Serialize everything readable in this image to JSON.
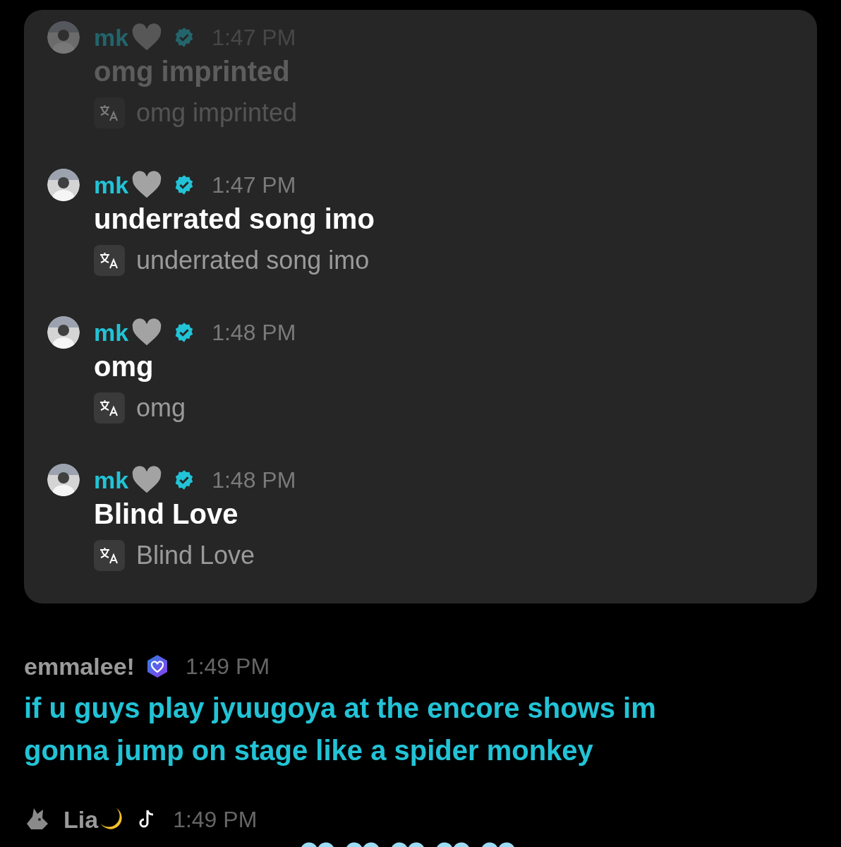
{
  "popup": {
    "messages": [
      {
        "author": "mk",
        "time": "1:47 PM",
        "faded": true,
        "text": "omg imprinted",
        "translation": "omg imprinted"
      },
      {
        "author": "mk",
        "time": "1:47 PM",
        "faded": false,
        "text": "underrated song imo",
        "translation": "underrated song imo"
      },
      {
        "author": "mk",
        "time": "1:48 PM",
        "faded": false,
        "text": "omg",
        "translation": "omg"
      },
      {
        "author": "mk",
        "time": "1:48 PM",
        "faded": false,
        "text": "Blind Love",
        "translation": "Blind Love"
      }
    ]
  },
  "chat": [
    {
      "kind": "badge",
      "author": "emmalee!",
      "time": "1:49 PM",
      "text": "if u guys play jyuugoya at the encore shows im gonna jump on stage like a spider monkey"
    },
    {
      "kind": "tiktok",
      "author": "Lia",
      "time": "1:49 PM"
    }
  ]
}
